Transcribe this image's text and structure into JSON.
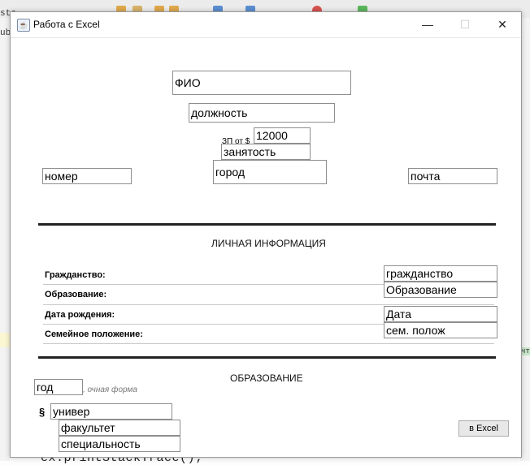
{
  "window": {
    "title": "Работа с Excel",
    "minimize_glyph": "—",
    "maximize_glyph": "☐",
    "close_glyph": "✕"
  },
  "background_ide": {
    "frag_top_left": "stc",
    "frag_left": "ub",
    "code_line": "ex.printStackTrace();",
    "frag_right": "чт"
  },
  "fields": {
    "fio": "ФИО",
    "position": "должность",
    "salary": "12000",
    "employment": "занятость",
    "city": "город",
    "number": "номер",
    "email": "почта",
    "citizenship": "гражданство",
    "education": "Образование",
    "birth_date": "Дата",
    "marital": "сем. полож",
    "year": "год",
    "university": "универ",
    "faculty": "факультет",
    "specialty": "специальность"
  },
  "labels": {
    "salary_prefix": "ЗП от $",
    "personal_info": "ЛИЧНАЯ ИНФОРМАЦИЯ",
    "citizenship": "Гражданство:",
    "education": "Образование:",
    "birth_date": "Дата рождения:",
    "marital": "Семейное положение:",
    "education_section": "ОБРАЗОВАНИЕ",
    "study_form": ", очная форма",
    "para_mark": "§"
  },
  "buttons": {
    "excel": "в Excel"
  }
}
